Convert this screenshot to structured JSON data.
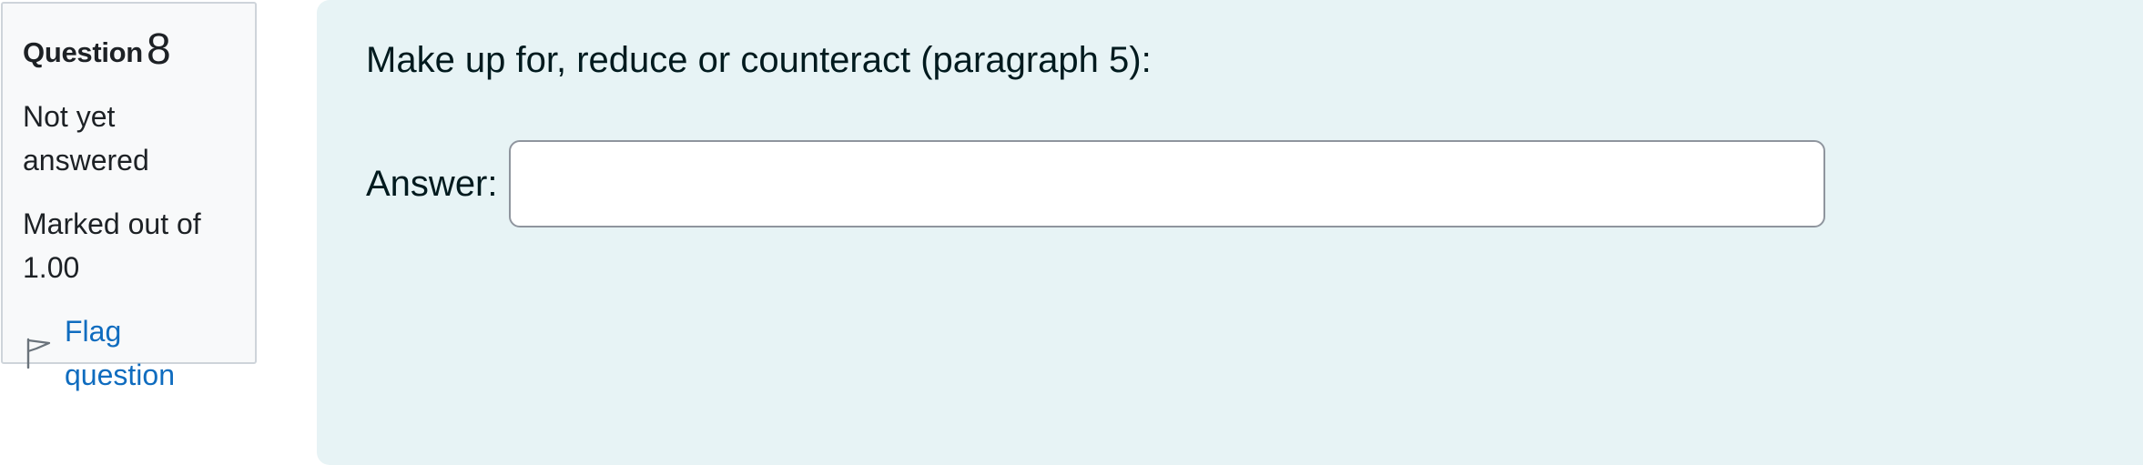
{
  "question_info": {
    "label": "Question",
    "number": "8",
    "state": "Not yet answered",
    "grade": "Marked out of 1.00",
    "flag_label": "Flag question",
    "flag_icon": "flag-icon"
  },
  "question": {
    "text": "Make up for, reduce or counteract (paragraph 5):",
    "answer_label": "Answer:",
    "answer_value": "",
    "answer_placeholder": ""
  },
  "colors": {
    "info_background": "#f8f9fa",
    "content_background": "#e7f3f5",
    "link": "#0f6cbf"
  }
}
